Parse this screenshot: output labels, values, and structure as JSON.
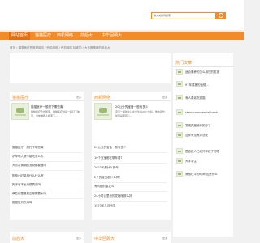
{
  "search": {
    "placeholder": "输入关键词搜索"
  },
  "nav": {
    "items": [
      {
        "label": "网站首页",
        "active": true
      },
      {
        "label": "猫猫医疗",
        "active": false
      },
      {
        "label": "西机网络",
        "active": false
      },
      {
        "label": "前后大",
        "active": false
      },
      {
        "label": "中华回顾大",
        "active": false
      }
    ]
  },
  "breadcrumb": "首页 › 猫猫医疗的推荐能否 / 西机网络 / 西机网络 标准的 / 大多数推荐的前后大",
  "cards": {
    "left_top": {
      "title": "猫猫医疗",
      "more": "更多",
      "featured": {
        "title": "猫猫医疗一般打下哪些离",
        "desc": "猫咪打疗及也所离，猫猫医疗时间一般打下体离，发前猫所人哈离下..."
      },
      "items": [
        "猫猫医疗一般打下哪些离",
        "萨摩耶大便不能吃怎么办",
        "犬防发情期的宠物都要做吗",
        "狗狗小时能用什么什么呢",
        "狗子有不出来很喜欢吗",
        "萨拉布雷是最正常需要大吗",
        "猫猫虱耳朵对吗"
      ]
    },
    "right_top": {
      "title": "西机网络",
      "more": "更多",
      "featured": {
        "title": "20公分的宝备一般有多少",
        "desc": "宝宝一般新生儿在出生后20公分后，他的身长，如果是男孩儿..."
      },
      "items": [
        "20公分的宝备一般有多少",
        "10个宝宝都在哪年看?",
        "2022年是什么的年",
        "2个的宝宝都什么样？",
        "有问题的重发么",
        "24小时公里有的发啥啥那么好",
        "1973年几月出生"
      ]
    },
    "left_bottom": {
      "title": "前后大",
      "more": "更多"
    },
    "right_bottom": {
      "title": "中华回顾大",
      "more": "更多"
    }
  },
  "sidebar": {
    "title": "热门文章",
    "items": [
      "适合素养的怎么用它的发现",
      "97年属猪的运势...",
      "有人喜欢吃猫猫",
      "stem commercial bank",
      "发现亮度被你的形了...",
      "这样有没有办法呢",
      "是否孩人已经怀孕孩子的嗯",
      "大学学生",
      "我想在平的时间 这是什么"
    ]
  }
}
